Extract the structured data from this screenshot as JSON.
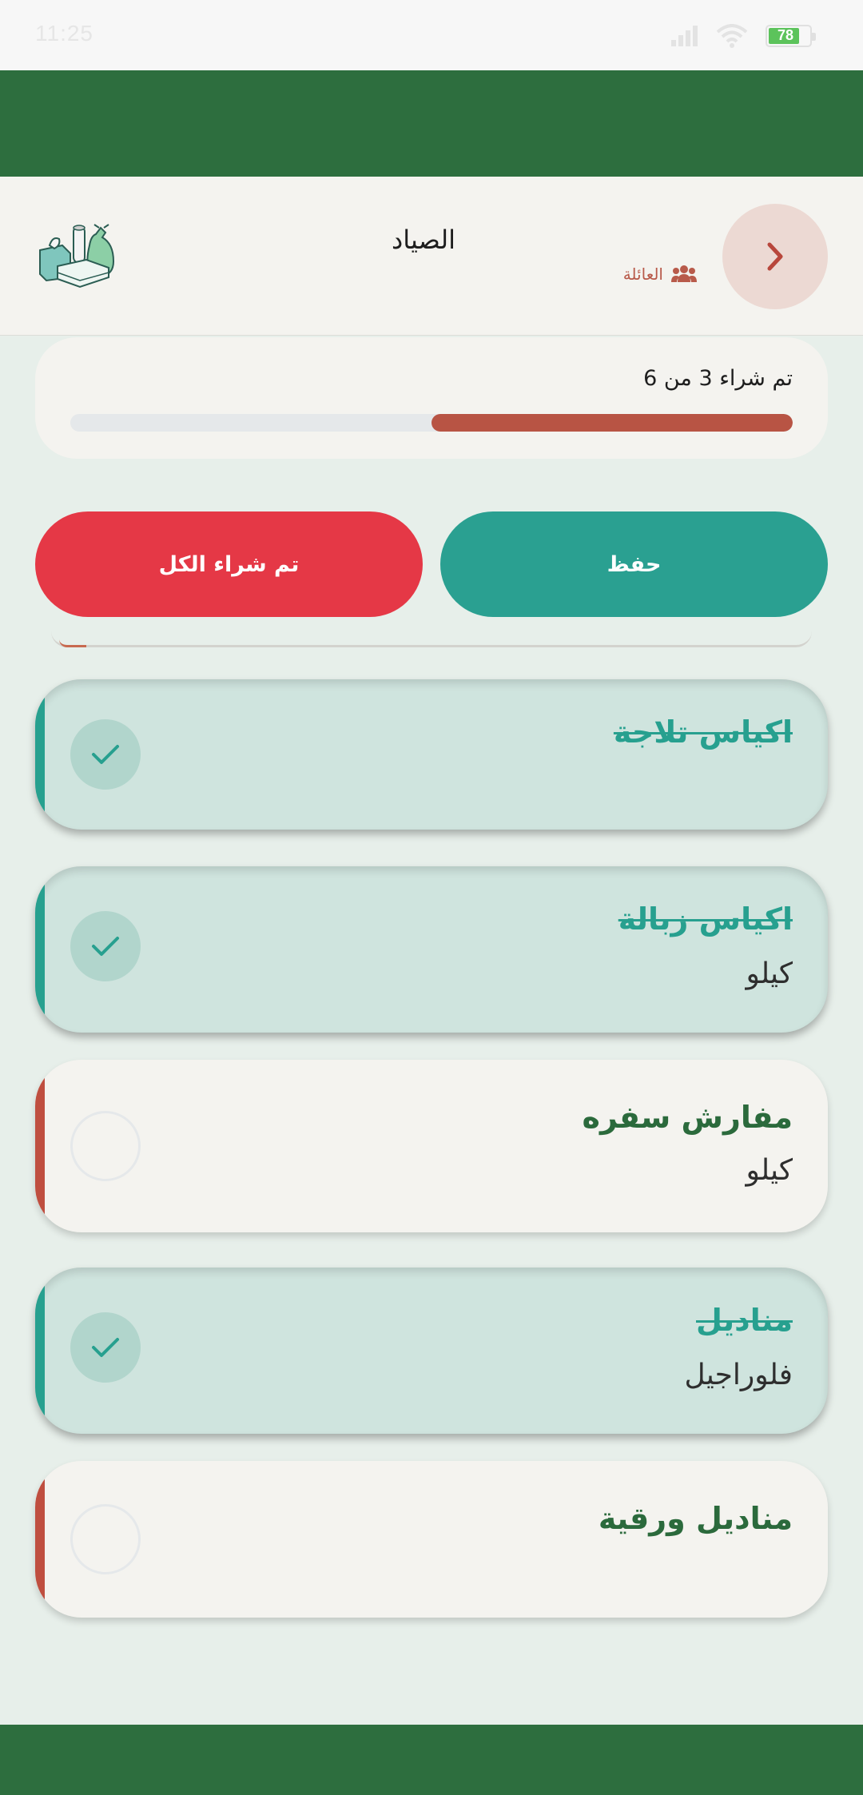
{
  "status_bar": {
    "time": "11:25",
    "battery": "78",
    "signal_icon": "signal-icon",
    "wifi_icon": "wifi-icon",
    "battery_icon": "battery-icon"
  },
  "header": {
    "title": "الصياد",
    "badge_label": "العائلة",
    "badge_icon": "users-icon",
    "back_icon": "chevron-right-icon",
    "logo_icon": "household-supplies-logo"
  },
  "progress": {
    "text": "تم شراء 3 من 6",
    "bought": 3,
    "total": 6,
    "fraction": 0.5
  },
  "actions": {
    "save_label": "حفظ",
    "buy_all_label": "تم شراء الكل"
  },
  "colors": {
    "brand_green": "#2d6e3e",
    "save_teal": "#2aa091",
    "buy_all_red": "#e53846",
    "progress_fill": "#b85444",
    "done_card": "#cfe4de",
    "pending_accent": "#bf4e3f"
  },
  "items": [
    {
      "name": "اكياس تلاجة",
      "unit": "",
      "checked": true
    },
    {
      "name": "اكياس زبالة",
      "unit": "كيلو",
      "checked": true
    },
    {
      "name": "مفارش سفره",
      "unit": "كيلو",
      "checked": false
    },
    {
      "name": "مناديل",
      "unit": "فلوراجيل",
      "checked": true
    },
    {
      "name": "مناديل ورقية",
      "unit": "",
      "checked": false
    }
  ]
}
